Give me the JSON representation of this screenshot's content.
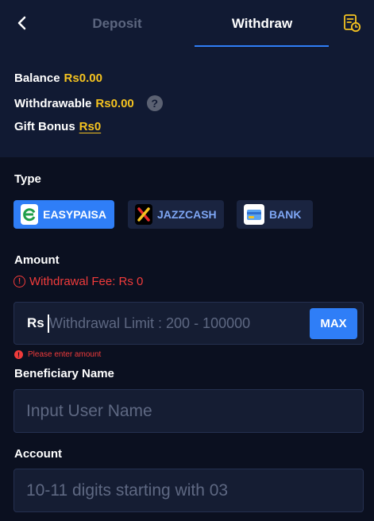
{
  "header": {
    "tabs": [
      {
        "label": "Deposit",
        "active": false
      },
      {
        "label": "Withdraw",
        "active": true
      }
    ],
    "back_icon": "chevron-left-icon",
    "records_icon": "records-clock-icon",
    "accent_color": "#2f7ef7"
  },
  "balance": {
    "balance_label": "Balance",
    "balance_value": "Rs0.00",
    "withdrawable_label": "Withdrawable",
    "withdrawable_value": "Rs0.00",
    "help_symbol": "?",
    "gift_label": "Gift Bonus",
    "gift_value": "Rs0",
    "value_color": "#f5c320"
  },
  "type": {
    "label": "Type",
    "methods": [
      {
        "label": "EASYPAISA",
        "icon": "easypaisa-logo-icon",
        "selected": true
      },
      {
        "label": "JAZZCASH",
        "icon": "jazzcash-logo-icon",
        "selected": false
      },
      {
        "label": "BANK",
        "icon": "bank-card-icon",
        "selected": false
      }
    ]
  },
  "amount": {
    "label": "Amount",
    "fee_text": "Withdrawal Fee: Rs 0",
    "currency": "Rs",
    "placeholder": "Withdrawal Limit : 200 - 100000",
    "value": "",
    "max_label": "MAX",
    "error_text": "Please enter amount",
    "error_color": "#f03b3b"
  },
  "beneficiary": {
    "label": "Beneficiary Name",
    "placeholder": "Input User Name",
    "value": ""
  },
  "account": {
    "label": "Account",
    "placeholder": "10-11 digits starting with 03",
    "value": ""
  }
}
